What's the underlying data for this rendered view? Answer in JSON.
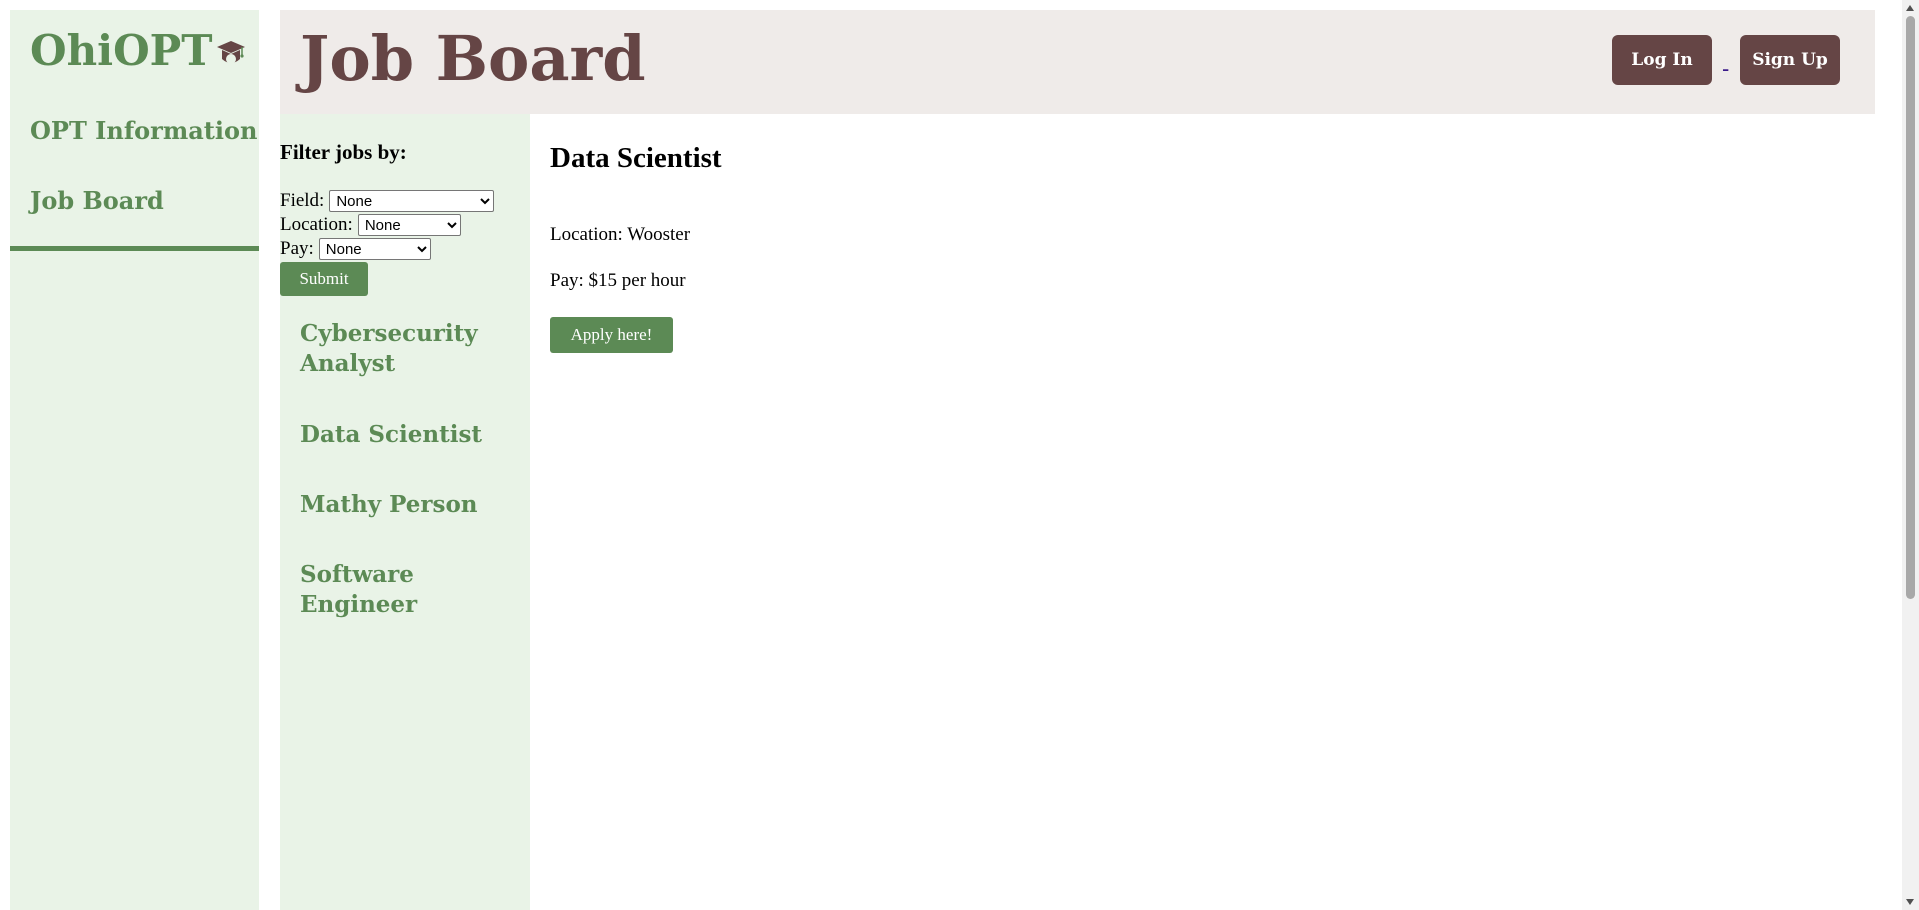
{
  "sidebar": {
    "logo_text": "OhiOPT",
    "logo_icon": "graduation-cap-icon",
    "items": [
      {
        "label": "OPT Information"
      },
      {
        "label": "Job Board"
      }
    ]
  },
  "header": {
    "title": "Job Board",
    "login_label": "Log In",
    "separator": "-",
    "signup_label": "Sign Up"
  },
  "filter": {
    "heading": "Filter jobs by:",
    "field_label": "Field:",
    "field_value": "None",
    "location_label": "Location:",
    "location_value": "None",
    "pay_label": "Pay:",
    "pay_value": "None",
    "submit_label": "Submit"
  },
  "jobs": [
    {
      "title": "Cybersecurity Analyst"
    },
    {
      "title": "Data Scientist"
    },
    {
      "title": "Mathy Person"
    },
    {
      "title": "Software Engineer"
    }
  ],
  "detail": {
    "title": "Data Scientist",
    "location": "Location: Wooster",
    "pay": "Pay: $15 per hour",
    "apply_label": "Apply here!"
  },
  "colors": {
    "green": "#5c8a55",
    "light_green_bg": "#e9f3e7",
    "brown": "#654545",
    "header_bg": "#efebe9"
  }
}
